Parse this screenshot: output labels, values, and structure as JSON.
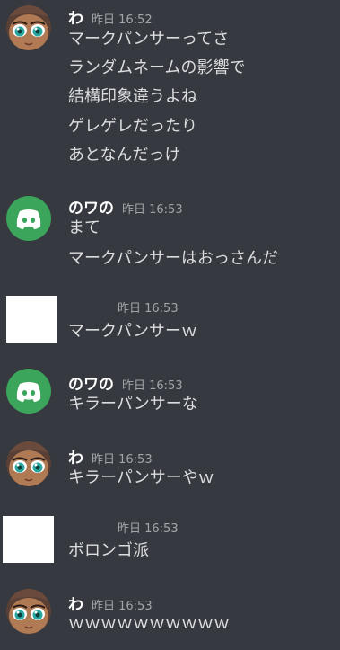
{
  "messages": [
    {
      "author": "わ",
      "time": "昨日 16:52",
      "avatar": "anime-character-avatar",
      "lines": [
        "マークパンサーってさ",
        "ランダムネームの影響で",
        "結構印象違うよね",
        "ゲレゲレだったり",
        "あとなんだっけ"
      ]
    },
    {
      "author": "のワの",
      "time": "昨日 16:53",
      "avatar": "discord-default-avatar",
      "accent": "#3ba55c",
      "lines": [
        "まて",
        "マークパンサーはおっさんだ"
      ]
    },
    {
      "author": "",
      "time": "昨日 16:53",
      "avatar": "blank-white-avatar",
      "lines": [
        "マークパンサーｗ"
      ]
    },
    {
      "author": "のワの",
      "time": "昨日 16:53",
      "avatar": "discord-default-avatar",
      "accent": "#3ba55c",
      "lines": [
        "キラーパンサーな"
      ]
    },
    {
      "author": "わ",
      "time": "昨日 16:53",
      "avatar": "anime-character-avatar",
      "lines": [
        "キラーパンサーやｗ"
      ]
    },
    {
      "author": "",
      "time": "昨日 16:53",
      "avatar": "blank-white-avatar",
      "lines": [
        "ボロンゴ派"
      ]
    },
    {
      "author": "わ",
      "time": "昨日 16:53",
      "avatar": "anime-character-avatar",
      "lines": [
        "ｗｗｗｗｗｗｗｗｗｗ"
      ]
    }
  ]
}
